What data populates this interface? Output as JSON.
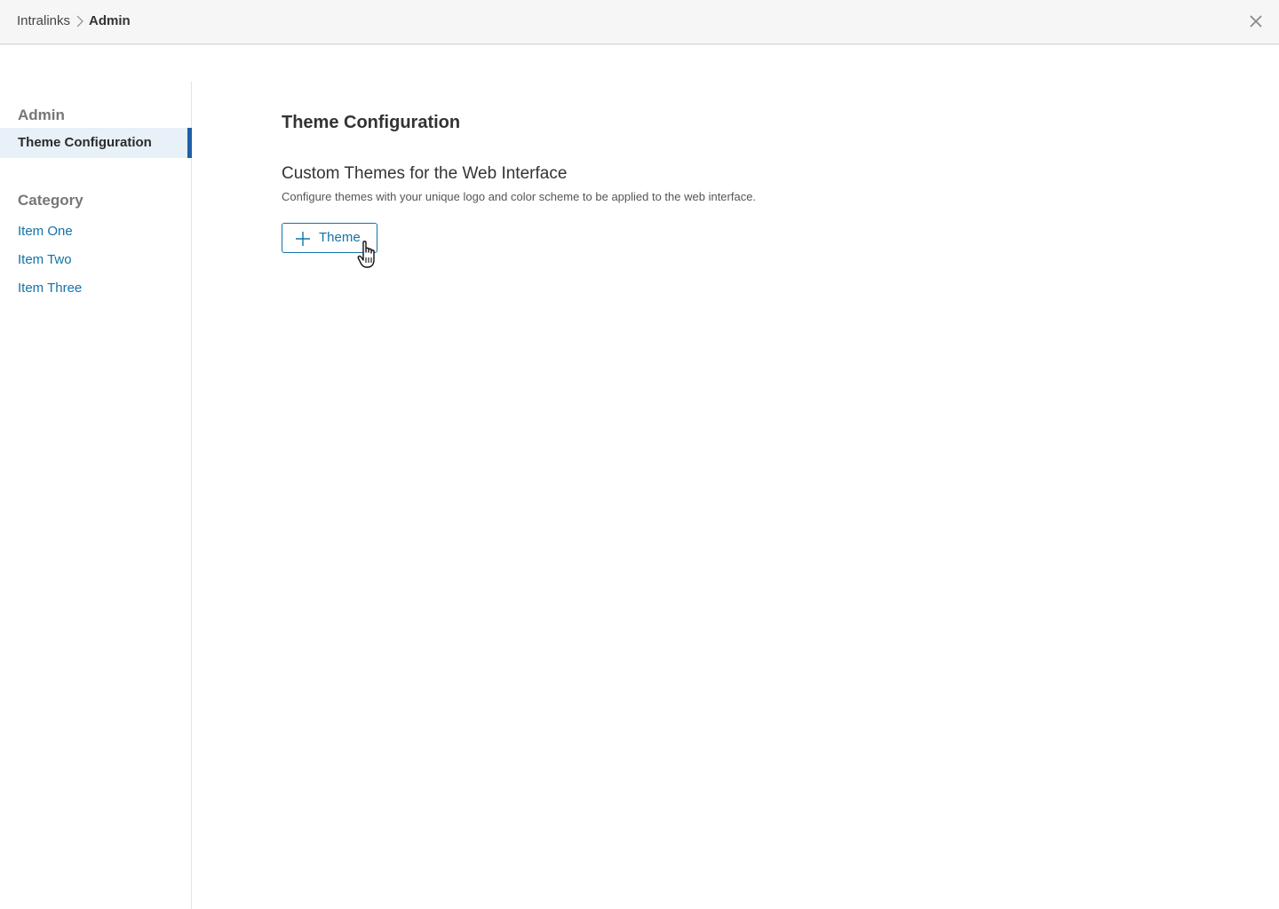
{
  "header": {
    "breadcrumb": [
      "Intralinks",
      "Admin"
    ],
    "close_icon": "close-icon"
  },
  "sidebar": {
    "section_heading": "Admin",
    "active_item": "Theme Configuration",
    "category_heading": "Category",
    "items": [
      {
        "label": "Item One"
      },
      {
        "label": "Item Two"
      },
      {
        "label": "Item Three"
      }
    ]
  },
  "main": {
    "title": "Theme Configuration",
    "section_title": "Custom Themes for the Web Interface",
    "section_description": "Configure themes with your unique logo and color scheme to be applied to the web interface.",
    "add_button_label": "Theme",
    "add_button_icon": "plus-icon"
  },
  "colors": {
    "accent": "#1372a8",
    "active_indicator": "#1f5fa8",
    "active_bg": "#e8f1f8",
    "topbar_bg": "#f6f6f6"
  }
}
